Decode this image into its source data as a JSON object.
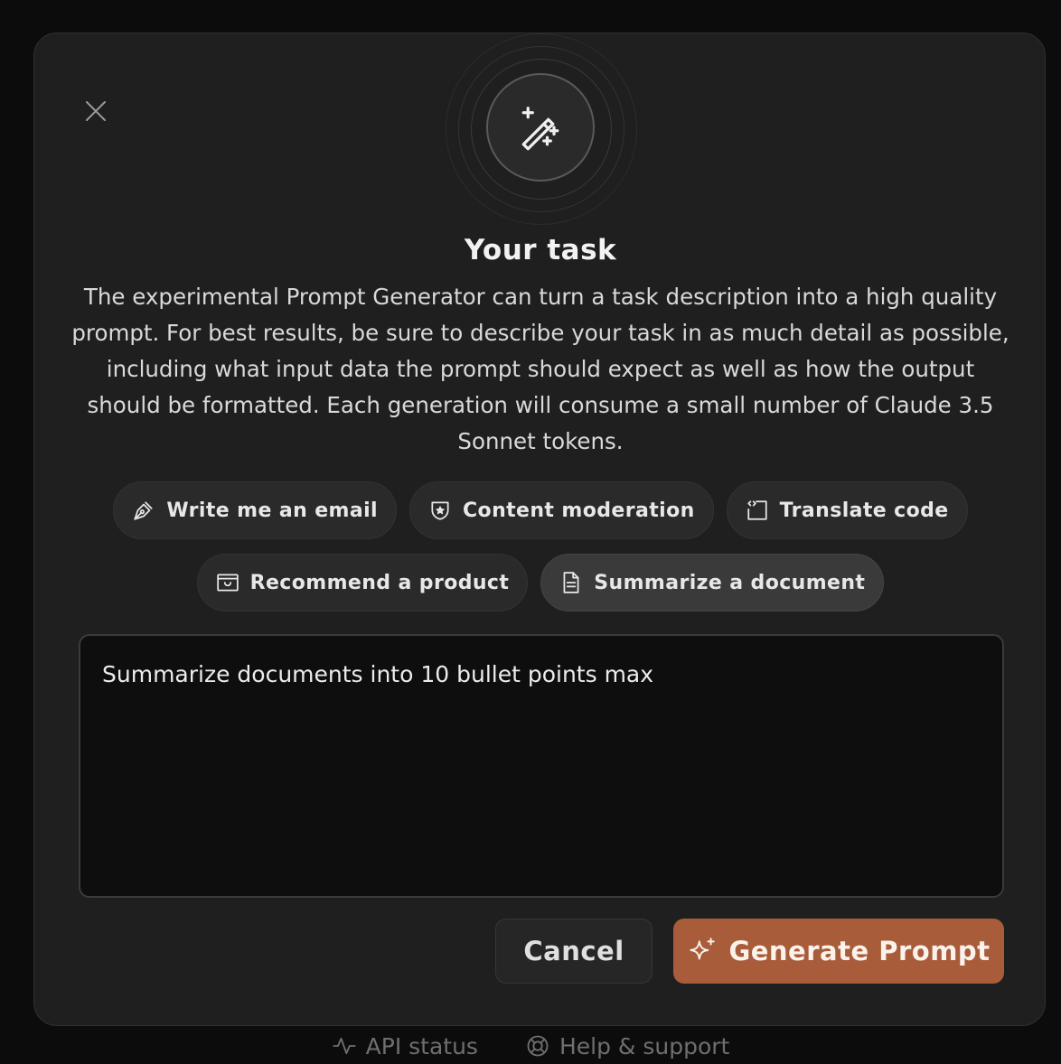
{
  "colors": {
    "accent": "#a85c3a",
    "modal_bg": "#1f1f1f",
    "page_bg": "#0c0c0c"
  },
  "footer": {
    "api_status_label": "API status",
    "api_status_icon": "activity-icon",
    "help_label": "Help & support",
    "help_icon": "lifebuoy-icon"
  },
  "modal": {
    "close_icon": "close-icon",
    "hero_icon": "magic-wand-icon",
    "title": "Your task",
    "description": "The experimental Prompt Generator can turn a task description into a high quality prompt. For best results, be sure to describe your task in as much detail as possible, including what input data the prompt should expect as well as how the output should be formatted. Each generation will consume a small number of Claude 3.5 Sonnet tokens.",
    "examples": [
      {
        "label": "Write me an email",
        "icon": "pen-icon",
        "selected": false
      },
      {
        "label": "Content moderation",
        "icon": "shield-star-icon",
        "selected": false
      },
      {
        "label": "Translate code",
        "icon": "code-window-icon",
        "selected": false
      },
      {
        "label": "Recommend a product",
        "icon": "shopping-box-icon",
        "selected": false
      },
      {
        "label": "Summarize a document",
        "icon": "document-icon",
        "selected": true
      }
    ],
    "task_input": {
      "value": "Summarize documents into 10 bullet points max"
    },
    "cancel_label": "Cancel",
    "generate_label": "Generate Prompt",
    "generate_icon": "sparkle-icon"
  }
}
